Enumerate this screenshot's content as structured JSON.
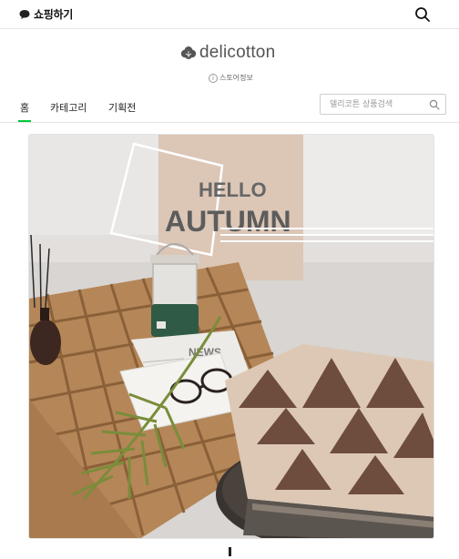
{
  "topbar": {
    "shop_label": "쇼핑하기",
    "chat_icon": "speech-bubble-icon",
    "search_icon": "search-icon"
  },
  "store": {
    "logo_text": "delicotton",
    "logo_icon": "cotton-flower-icon",
    "info_label": "스토어정보",
    "info_icon": "info-circle-icon"
  },
  "nav": {
    "tabs": [
      {
        "label": "홈"
      },
      {
        "label": "카테고리"
      },
      {
        "label": "기획전"
      }
    ],
    "active_color": "#00c73c",
    "search_placeholder": "델리코튼 상품검색"
  },
  "banner": {
    "headline_1": "HELLO",
    "headline_2": "AUTUMN",
    "newspaper_text": "NEWS"
  }
}
